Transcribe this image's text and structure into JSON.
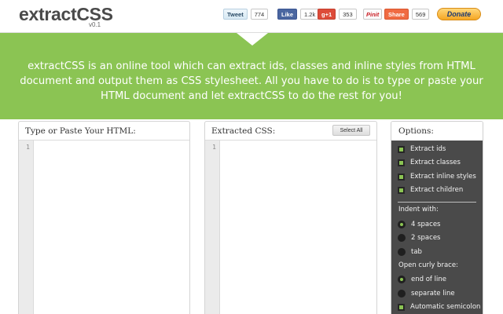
{
  "header": {
    "logo": "extractCSS",
    "version": "v0.1",
    "tweet_label": "Tweet",
    "tweet_count": "774",
    "like_label": "Like",
    "like_count": "1.2k",
    "gplus_label": "g+1",
    "gplus_count": "353",
    "pin_label": "Pinit",
    "share_label": "Share",
    "share_count": "569",
    "donate_label": "Donate"
  },
  "banner": {
    "tagline_line1": "extractCSS is an online tool which can extract ids, classes and inline styles from HTML",
    "tagline_line2": "document and output them as CSS stylesheet. All you have to do is to type or paste your",
    "tagline_line3": "HTML document and let extractCSS to do the rest for you!",
    "color": "#8bc453"
  },
  "html_panel": {
    "title": "Type or Paste Your HTML:",
    "line_number": "1"
  },
  "css_panel": {
    "title": "Extracted CSS:",
    "select_all_label": "Select All",
    "line_number": "1"
  },
  "options": {
    "title": "Options:",
    "extract": [
      {
        "label": "Extract ids",
        "checked": true
      },
      {
        "label": "Extract classes",
        "checked": true
      },
      {
        "label": "Extract inline styles",
        "checked": true
      },
      {
        "label": "Extract children",
        "checked": true
      }
    ],
    "indent_label": "Indent with:",
    "indent": [
      {
        "label": "4 spaces",
        "selected": true
      },
      {
        "label": "2 spaces",
        "selected": false
      },
      {
        "label": "tab",
        "selected": false
      }
    ],
    "brace_label": "Open curly brace:",
    "brace": [
      {
        "label": "end of line",
        "selected": true
      },
      {
        "label": "separate line",
        "selected": false
      }
    ],
    "semicolon": {
      "label": "Automatic semicolon",
      "checked": true
    }
  }
}
